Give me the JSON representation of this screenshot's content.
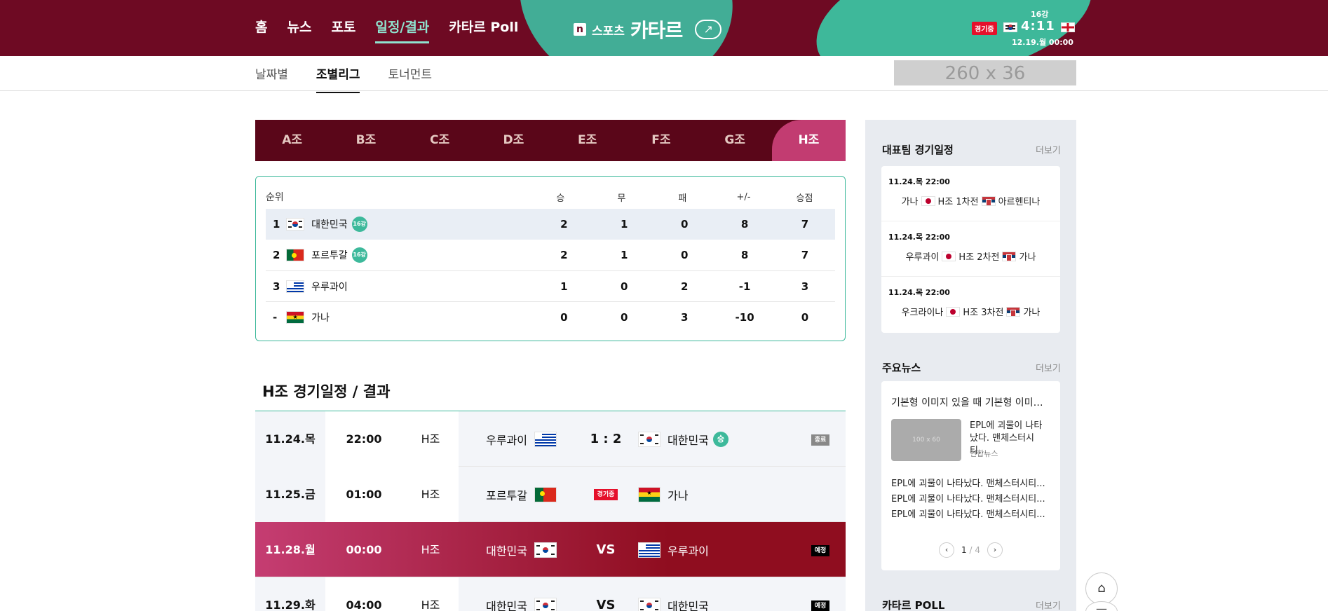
{
  "nav": {
    "items": [
      {
        "label": "홈"
      },
      {
        "label": "뉴스"
      },
      {
        "label": "포토"
      },
      {
        "label": "일정/결과",
        "active": true
      },
      {
        "label": "카타르 Poll"
      }
    ]
  },
  "brand": {
    "n": "n",
    "sports": "스포츠",
    "title": "카타르",
    "share": "↗"
  },
  "live_match": {
    "round": "16강",
    "status": "경기중",
    "score": "4:11",
    "date": "12.19.월 00:00"
  },
  "subnav": {
    "tabs": [
      {
        "label": "날짜별"
      },
      {
        "label": "조별리그",
        "active": true
      },
      {
        "label": "토너먼트"
      }
    ],
    "ad": "260 x 36"
  },
  "group_tabs": [
    "A조",
    "B조",
    "C조",
    "D조",
    "E조",
    "F조",
    "G조",
    "H조"
  ],
  "standings": {
    "headers": {
      "rank": "순위",
      "w": "승",
      "d": "무",
      "l": "패",
      "gd": "+/-",
      "pts": "승점"
    },
    "rows": [
      {
        "rank": "1",
        "team": "대한민국",
        "badge": "16강",
        "w": "2",
        "d": "1",
        "l": "0",
        "gd": "8",
        "pts": "7"
      },
      {
        "rank": "2",
        "team": "포르투갈",
        "badge": "16강",
        "w": "2",
        "d": "1",
        "l": "0",
        "gd": "8",
        "pts": "7"
      },
      {
        "rank": "3",
        "team": "우루과이",
        "badge": "",
        "w": "1",
        "d": "0",
        "l": "2",
        "gd": "-1",
        "pts": "3"
      },
      {
        "rank": "-",
        "team": "가나",
        "badge": "",
        "w": "0",
        "d": "0",
        "l": "3",
        "gd": "-10",
        "pts": "0"
      }
    ]
  },
  "schedule": {
    "title": "H조 경기일정 / 결과",
    "matches": [
      {
        "date": "11.24.목",
        "time": "22:00",
        "group": "H조",
        "home": "우루과이",
        "score": "1 : 2",
        "away": "대한민국",
        "win": "승",
        "status": "종료"
      },
      {
        "date": "11.25.금",
        "time": "01:00",
        "group": "H조",
        "home": "포르투갈",
        "score": "경기중",
        "away": "가나",
        "status": ""
      },
      {
        "date": "11.28.월",
        "time": "00:00",
        "group": "H조",
        "home": "대한민국",
        "score": "VS",
        "away": "우루과이",
        "status": "예정"
      },
      {
        "date": "11.29.화",
        "time": "04:00",
        "group": "H조",
        "home": "대한민국",
        "score": "VS",
        "away": "대한민국",
        "status": "예정"
      }
    ]
  },
  "sidebar": {
    "team_schedule": {
      "title": "대표팀 경기일정",
      "more": "더보기",
      "items": [
        {
          "date": "11.24.목 22:00",
          "home": "가나",
          "label": "H조 1차전",
          "away": "아르헨티나"
        },
        {
          "date": "11.24.목 22:00",
          "home": "우루과이",
          "label": "H조 2차전",
          "away": "가나"
        },
        {
          "date": "11.24.목 22:00",
          "home": "우크라이나",
          "label": "H조 3차전",
          "away": "가나"
        }
      ]
    },
    "news": {
      "title": "주요뉴스",
      "more": "더보기",
      "headline": "기본형 이미지 있을 때 기본형 이미지...",
      "thumb": "100 x 60",
      "side_text": "EPL에 괴물이 나타났다. 맨체스터시티...",
      "source": "연합뉴스",
      "list": [
        "EPL에 괴물이 나타났다. 맨체스터시티...",
        "EPL에 괴물이 나타났다. 맨체스터시티...",
        "EPL에 괴물이 나타났다. 맨체스터시티..."
      ],
      "pager": {
        "current": "1",
        "total": "/ 4"
      }
    },
    "poll": {
      "title": "카타르 POLL",
      "more": "더보기"
    }
  }
}
